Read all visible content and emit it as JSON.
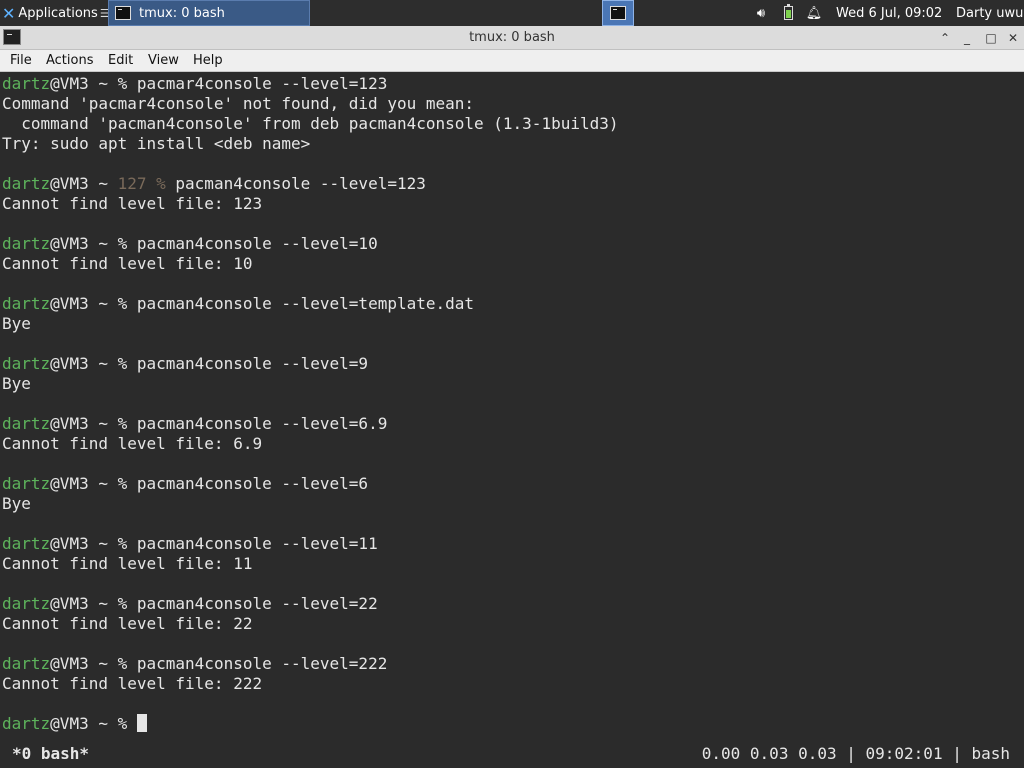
{
  "panel": {
    "applications_label": "Applications",
    "task_label": "tmux: 0 bash",
    "clock": "Wed  6 Jul, 09:02",
    "user": "Darty uwu",
    "icons": [
      "xfce-logo-icon",
      "terminal-icon",
      "volume-icon",
      "battery-icon",
      "notification-bell-icon"
    ]
  },
  "window": {
    "title": "tmux: 0 bash",
    "menu": [
      "File",
      "Actions",
      "Edit",
      "View",
      "Help"
    ]
  },
  "terminal": {
    "lines": [
      {
        "user": "dartz",
        "host": "@VM3 ~ ",
        "status": "",
        "cmd": "% pacmar4console --level=123"
      },
      {
        "text": "Command 'pacmar4console' not found, did you mean:"
      },
      {
        "text": "  command 'pacman4console' from deb pacman4console (1.3-1build3)"
      },
      {
        "text": "Try: sudo apt install <deb name>"
      },
      {
        "text": ""
      },
      {
        "user": "dartz",
        "host": "@VM3 ~ ",
        "status": "127 % ",
        "cmd": "pacman4console --level=123"
      },
      {
        "text": "Cannot find level file: 123"
      },
      {
        "text": ""
      },
      {
        "user": "dartz",
        "host": "@VM3 ~ ",
        "status": "",
        "cmd": "% pacman4console --level=10"
      },
      {
        "text": "Cannot find level file: 10"
      },
      {
        "text": ""
      },
      {
        "user": "dartz",
        "host": "@VM3 ~ ",
        "status": "",
        "cmd": "% pacman4console --level=template.dat"
      },
      {
        "text": "Bye"
      },
      {
        "text": ""
      },
      {
        "user": "dartz",
        "host": "@VM3 ~ ",
        "status": "",
        "cmd": "% pacman4console --level=9"
      },
      {
        "text": "Bye"
      },
      {
        "text": ""
      },
      {
        "user": "dartz",
        "host": "@VM3 ~ ",
        "status": "",
        "cmd": "% pacman4console --level=6.9"
      },
      {
        "text": "Cannot find level file: 6.9"
      },
      {
        "text": ""
      },
      {
        "user": "dartz",
        "host": "@VM3 ~ ",
        "status": "",
        "cmd": "% pacman4console --level=6"
      },
      {
        "text": "Bye"
      },
      {
        "text": ""
      },
      {
        "user": "dartz",
        "host": "@VM3 ~ ",
        "status": "",
        "cmd": "% pacman4console --level=11"
      },
      {
        "text": "Cannot find level file: 11"
      },
      {
        "text": ""
      },
      {
        "user": "dartz",
        "host": "@VM3 ~ ",
        "status": "",
        "cmd": "% pacman4console --level=22"
      },
      {
        "text": "Cannot find level file: 22"
      },
      {
        "text": ""
      },
      {
        "user": "dartz",
        "host": "@VM3 ~ ",
        "status": "",
        "cmd": "% pacman4console --level=222"
      },
      {
        "text": "Cannot find level file: 222"
      },
      {
        "text": ""
      },
      {
        "user": "dartz",
        "host": "@VM3 ~ ",
        "status": "",
        "cmd": "% ",
        "cursor": true
      }
    ]
  },
  "tmux": {
    "window_label": "*0 bash*",
    "status_right": "0.00 0.03 0.03 | 09:02:01 | bash"
  },
  "colors": {
    "terminal_bg": "#2b2b2b",
    "username_green": "#5db35b",
    "panel_bg": "#2d2d2d",
    "active_task": "#3a5a86"
  }
}
